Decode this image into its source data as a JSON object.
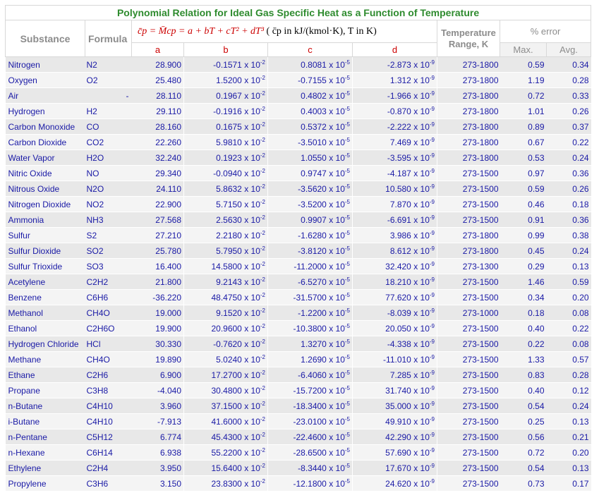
{
  "title": "Polynomial Relation for Ideal Gas Specific Heat as a Function of Temperature",
  "headers": {
    "substance": "Substance",
    "formula": "Formula",
    "equation": "c̄p = M̄cp = a + bT + cT² + dT³",
    "equation_note": "( c̄p in kJ/(kmol·K), T in K)",
    "coef_a": "a",
    "coef_b": "b",
    "coef_c": "c",
    "coef_d": "d",
    "range_line1": "Temperature",
    "range_line2": "Range, K",
    "error": "% error",
    "error_max": "Max.",
    "error_avg": "Avg."
  },
  "exp_b": "-2",
  "exp_c": "-5",
  "exp_d": "-9",
  "rows": [
    {
      "substance": "Nitrogen",
      "formula": "N2",
      "a": "28.900",
      "b": "-0.1571",
      "c": "0.8081",
      "d": "-2.873",
      "range": "273-1800",
      "max": "0.59",
      "avg": "0.34"
    },
    {
      "substance": "Oxygen",
      "formula": "O2",
      "a": "25.480",
      "b": "1.5200",
      "c": "-0.7155",
      "d": "1.312",
      "range": "273-1800",
      "max": "1.19",
      "avg": "0.28"
    },
    {
      "substance": "Air",
      "formula": "-",
      "a": "28.110",
      "b": "0.1967",
      "c": "0.4802",
      "d": "-1.966",
      "range": "273-1800",
      "max": "0.72",
      "avg": "0.33"
    },
    {
      "substance": "Hydrogen",
      "formula": "H2",
      "a": "29.110",
      "b": "-0.1916",
      "c": "0.4003",
      "d": "-0.870",
      "range": "273-1800",
      "max": "1.01",
      "avg": "0.26"
    },
    {
      "substance": "Carbon Monoxide",
      "formula": "CO",
      "a": "28.160",
      "b": "0.1675",
      "c": "0.5372",
      "d": "-2.222",
      "range": "273-1800",
      "max": "0.89",
      "avg": "0.37"
    },
    {
      "substance": "Carbon Dioxide",
      "formula": "CO2",
      "a": "22.260",
      "b": "5.9810",
      "c": "-3.5010",
      "d": "7.469",
      "range": "273-1800",
      "max": "0.67",
      "avg": "0.22"
    },
    {
      "substance": "Water Vapor",
      "formula": "H2O",
      "a": "32.240",
      "b": "0.1923",
      "c": "1.0550",
      "d": "-3.595",
      "range": "273-1800",
      "max": "0.53",
      "avg": "0.24"
    },
    {
      "substance": "Nitric Oxide",
      "formula": "NO",
      "a": "29.340",
      "b": "-0.0940",
      "c": "0.9747",
      "d": "-4.187",
      "range": "273-1500",
      "max": "0.97",
      "avg": "0.36"
    },
    {
      "substance": "Nitrous Oxide",
      "formula": "N2O",
      "a": "24.110",
      "b": "5.8632",
      "c": "-3.5620",
      "d": "10.580",
      "range": "273-1500",
      "max": "0.59",
      "avg": "0.26"
    },
    {
      "substance": "Nitrogen Dioxide",
      "formula": "NO2",
      "a": "22.900",
      "b": "5.7150",
      "c": "-3.5200",
      "d": "7.870",
      "range": "273-1500",
      "max": "0.46",
      "avg": "0.18"
    },
    {
      "substance": "Ammonia",
      "formula": "NH3",
      "a": "27.568",
      "b": "2.5630",
      "c": "0.9907",
      "d": "-6.691",
      "range": "273-1500",
      "max": "0.91",
      "avg": "0.36"
    },
    {
      "substance": "Sulfur",
      "formula": "S2",
      "a": "27.210",
      "b": "2.2180",
      "c": "-1.6280",
      "d": "3.986",
      "range": "273-1800",
      "max": "0.99",
      "avg": "0.38"
    },
    {
      "substance": "Sulfur Dioxide",
      "formula": "SO2",
      "a": "25.780",
      "b": "5.7950",
      "c": "-3.8120",
      "d": "8.612",
      "range": "273-1800",
      "max": "0.45",
      "avg": "0.24"
    },
    {
      "substance": "Sulfur Trioxide",
      "formula": "SO3",
      "a": "16.400",
      "b": "14.5800",
      "c": "-11.2000",
      "d": "32.420",
      "range": "273-1300",
      "max": "0.29",
      "avg": "0.13"
    },
    {
      "substance": "Acetylene",
      "formula": "C2H2",
      "a": "21.800",
      "b": "9.2143",
      "c": "-6.5270",
      "d": "18.210",
      "range": "273-1500",
      "max": "1.46",
      "avg": "0.59"
    },
    {
      "substance": "Benzene",
      "formula": "C6H6",
      "a": "-36.220",
      "b": "48.4750",
      "c": "-31.5700",
      "d": "77.620",
      "range": "273-1500",
      "max": "0.34",
      "avg": "0.20"
    },
    {
      "substance": "Methanol",
      "formula": "CH4O",
      "a": "19.000",
      "b": "9.1520",
      "c": "-1.2200",
      "d": "-8.039",
      "range": "273-1000",
      "max": "0.18",
      "avg": "0.08"
    },
    {
      "substance": "Ethanol",
      "formula": "C2H6O",
      "a": "19.900",
      "b": "20.9600",
      "c": "-10.3800",
      "d": "20.050",
      "range": "273-1500",
      "max": "0.40",
      "avg": "0.22"
    },
    {
      "substance": "Hydrogen Chloride",
      "formula": "HCl",
      "a": "30.330",
      "b": "-0.7620",
      "c": "1.3270",
      "d": "-4.338",
      "range": "273-1500",
      "max": "0.22",
      "avg": "0.08"
    },
    {
      "substance": "Methane",
      "formula": "CH4O",
      "a": "19.890",
      "b": "5.0240",
      "c": "1.2690",
      "d": "-11.010",
      "range": "273-1500",
      "max": "1.33",
      "avg": "0.57"
    },
    {
      "substance": "Ethane",
      "formula": "C2H6",
      "a": "6.900",
      "b": "17.2700",
      "c": "-6.4060",
      "d": "7.285",
      "range": "273-1500",
      "max": "0.83",
      "avg": "0.28"
    },
    {
      "substance": "Propane",
      "formula": "C3H8",
      "a": "-4.040",
      "b": "30.4800",
      "c": "-15.7200",
      "d": "31.740",
      "range": "273-1500",
      "max": "0.40",
      "avg": "0.12"
    },
    {
      "substance": "n-Butane",
      "formula": "C4H10",
      "a": "3.960",
      "b": "37.1500",
      "c": "-18.3400",
      "d": "35.000",
      "range": "273-1500",
      "max": "0.54",
      "avg": "0.24"
    },
    {
      "substance": "i-Butane",
      "formula": "C4H10",
      "a": "-7.913",
      "b": "41.6000",
      "c": "-23.0100",
      "d": "49.910",
      "range": "273-1500",
      "max": "0.25",
      "avg": "0.13"
    },
    {
      "substance": "n-Pentane",
      "formula": "C5H12",
      "a": "6.774",
      "b": "45.4300",
      "c": "-22.4600",
      "d": "42.290",
      "range": "273-1500",
      "max": "0.56",
      "avg": "0.21"
    },
    {
      "substance": "n-Hexane",
      "formula": "C6H14",
      "a": "6.938",
      "b": "55.2200",
      "c": "-28.6500",
      "d": "57.690",
      "range": "273-1500",
      "max": "0.72",
      "avg": "0.20"
    },
    {
      "substance": "Ethylene",
      "formula": "C2H4",
      "a": "3.950",
      "b": "15.6400",
      "c": "-8.3440",
      "d": "17.670",
      "range": "273-1500",
      "max": "0.54",
      "avg": "0.13"
    },
    {
      "substance": "Propylene",
      "formula": "C3H6",
      "a": "3.150",
      "b": "23.8300",
      "c": "-12.1800",
      "d": "24.620",
      "range": "273-1500",
      "max": "0.73",
      "avg": "0.17"
    }
  ]
}
